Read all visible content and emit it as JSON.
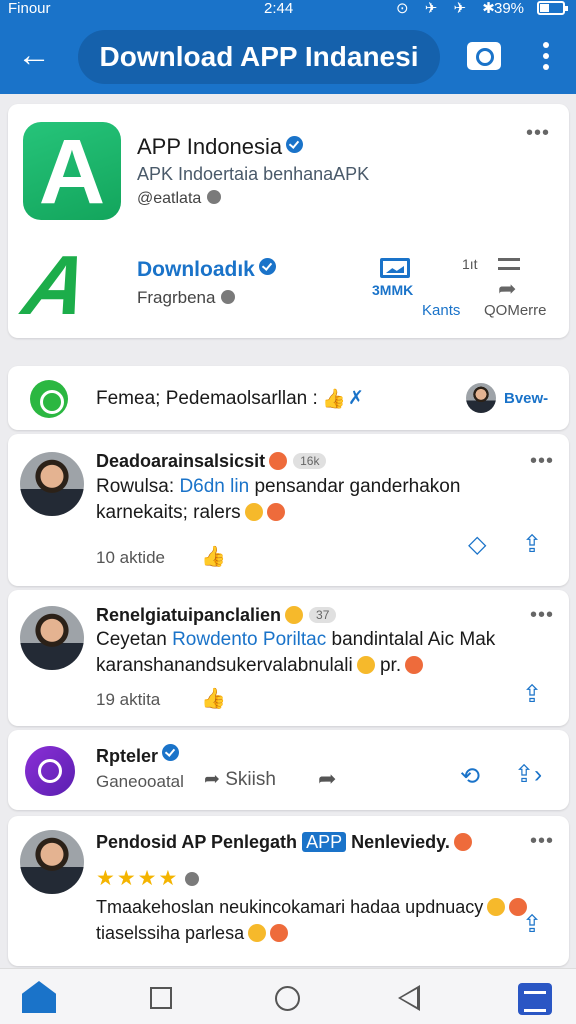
{
  "status_bar": {
    "carrier": "Finour",
    "time": "2:44",
    "icons": "⊙ ✈ ✈ ✱",
    "battery": "39%",
    "battery_level": 0.39
  },
  "app_bar": {
    "title": "Download APP Indanesi"
  },
  "app_card": {
    "name": "APP Indonesia",
    "subtitle": "APK Indoertaia benhanaAPK",
    "handle": "@eatlata",
    "download_title": "Downloadık",
    "download_sub": "Fragrbena",
    "stat_value": "3MMK",
    "stat_label": "Kants",
    "count_label": "1ıt",
    "share_label": "QOMerre"
  },
  "thread": {
    "text": "Femea; Pedemaolsarllan :",
    "thumb": "👍",
    "x_mark": "✗",
    "view_label": "Bvew-"
  },
  "posts": [
    {
      "title": "Deadoarainsalsicsit",
      "badge": "16k",
      "body_prefix": "Rowulsa:",
      "body_link": "D6dn lin",
      "body_rest": "pensandar ganderhakon",
      "body_line2": "karnekaits; ralers",
      "meta": "10 aktide"
    },
    {
      "title": "Renelgiatuipanclalien",
      "badge": "37",
      "body_prefix": "Ceyetan",
      "body_link": "Rowdento Poriltac",
      "body_rest": "bandintalal Aic Mak",
      "body_line2": "karanshanandsukervalabnulali",
      "body_tail": "pr.",
      "meta": "19 aktita"
    }
  ],
  "messenger_item": {
    "title": "Rpteler",
    "subtitle": "Ganeooatal",
    "skish": "Skiish"
  },
  "review": {
    "title": "Pendosid AP Penlegath",
    "app_tag": "APP",
    "title_rest": "Nenleviedy.",
    "stars": "★★★★",
    "rating": 4,
    "body_line1": "Tmaakehoslan neukincokamari hadaa updnuacy",
    "body_line2": "tiaselssiha parlesa"
  },
  "nav": {
    "items": [
      "home-icon",
      "recent-apps-icon",
      "home-circle-icon",
      "back-triangle-icon",
      "menu-icon"
    ]
  }
}
